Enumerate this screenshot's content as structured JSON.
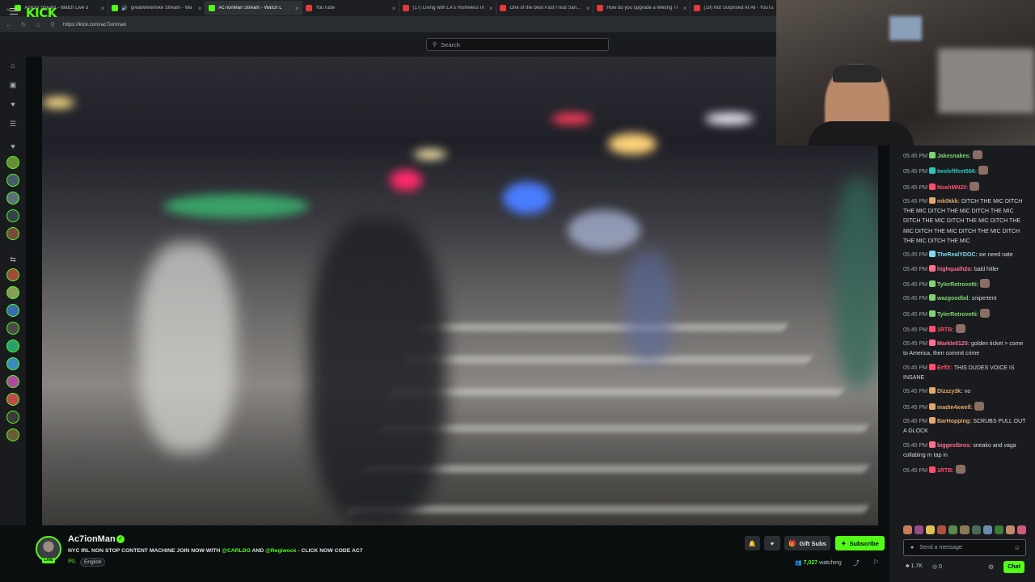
{
  "browser": {
    "tabs": [
      {
        "title": "AnRay Stream - Watch Live o",
        "icon_color": "#53fc18",
        "active": false
      },
      {
        "title": "greatwhitemike Stream - Wa",
        "icon_color": "#53fc18",
        "active": false,
        "audio": true
      },
      {
        "title": "Ac7ionMan Stream - Watch L",
        "icon_color": "#53fc18",
        "active": true
      },
      {
        "title": "YouTube",
        "icon_color": "#e53935",
        "active": false
      },
      {
        "title": "(17) Living with LA's Homeless In",
        "icon_color": "#e53935",
        "active": false
      },
      {
        "title": "One of the Best Fast Food Sandwi",
        "icon_color": "#e53935",
        "active": false
      },
      {
        "title": "How do you upgrade a lifelong Tr",
        "icon_color": "#e53935",
        "active": false
      },
      {
        "title": "(19) Not Surprised At All - YouTu",
        "icon_color": "#e53935",
        "active": false
      }
    ],
    "url": "https://kick.com/ac7ionman"
  },
  "header": {
    "logo": "KICK",
    "search_placeholder": "Search"
  },
  "stream": {
    "channel_name": "Ac7ionMan",
    "live_label": "LIVE",
    "title_prefix": "NYC IRL NON STOP CONTENT MACHINE JOIN NOW-WITH ",
    "mention1": "@CARLDO",
    "title_mid": " AND ",
    "mention2": "@Regiwock",
    "title_suffix": " - CLICK NOW CODE AC7",
    "category": "IRL",
    "tag": "English",
    "viewers_count": "7,027",
    "viewers_label": "watching",
    "gift_subs_label": "Gift Subs",
    "subscribe_label": "Subscribe"
  },
  "chat": {
    "messages": [
      {
        "time": "05:45 PM",
        "user": "Jakesnakes:",
        "color": "#7ed56f",
        "text": ""
      },
      {
        "time": "05:45 PM",
        "user": "twoleftfeet666:",
        "color": "#2ec4b6",
        "text": ""
      },
      {
        "time": "05:45 PM",
        "user": "NoahMN20:",
        "color": "#ff4d6d",
        "text": ""
      },
      {
        "time": "05:45 PM",
        "user": "mk0kkk:",
        "color": "#e3a869",
        "text": "DITCH THE MIC DITCH THE MIC DITCH THE MIC DITCH THE MIC DITCH THE MIC DITCH THE MIC DITCH THE MIC DITCH THE MIC DITCH THE MIC DITCH THE MIC DITCH THE MIC"
      },
      {
        "time": "05:45 PM",
        "user": "TheRealYDOC:",
        "color": "#7fd9f5",
        "text": "we need nate"
      },
      {
        "time": "05:45 PM",
        "user": "highqualh2o:",
        "color": "#ff6f91",
        "text": "bald hitler"
      },
      {
        "time": "05:45 PM",
        "user": "TylerRetrovetti:",
        "color": "#7ed56f",
        "text": ""
      },
      {
        "time": "05:45 PM",
        "user": "wazgoodbd:",
        "color": "#7ed56f",
        "text": "snipertent"
      },
      {
        "time": "05:45 PM",
        "user": "TylerRetrovetti:",
        "color": "#7ed56f",
        "text": ""
      },
      {
        "time": "05:45 PM",
        "user": "1RTB:",
        "color": "#ff4d6d",
        "text": ""
      },
      {
        "time": "05:45 PM",
        "user": "Markle0125:",
        "color": "#ff6f91",
        "text": "golden ticket > come to America, then commit crime"
      },
      {
        "time": "05:45 PM",
        "user": "ErffX:",
        "color": "#ff4d6d",
        "text": "THIS DUDES VOICE IS INSANE"
      },
      {
        "time": "05:45 PM",
        "user": "Dizzzy3k:",
        "color": "#e3a869",
        "text": "no"
      },
      {
        "time": "05:45 PM",
        "user": "madm4xwell:",
        "color": "#e3a869",
        "text": ""
      },
      {
        "time": "05:45 PM",
        "user": "BarHopping:",
        "color": "#e3a869",
        "text": "SCRUBS PULL OUT A GLOCK"
      },
      {
        "time": "05:45 PM",
        "user": "biggestbros:",
        "color": "#ff6f91",
        "text": "sneako and vaga collabing rn tap in"
      },
      {
        "time": "05:45 PM",
        "user": "1RTB:",
        "color": "#ff4d6d",
        "text": ""
      }
    ],
    "input_placeholder": "Send a message",
    "followers": "1.7K",
    "points": "0",
    "chat_button": "Chat"
  }
}
